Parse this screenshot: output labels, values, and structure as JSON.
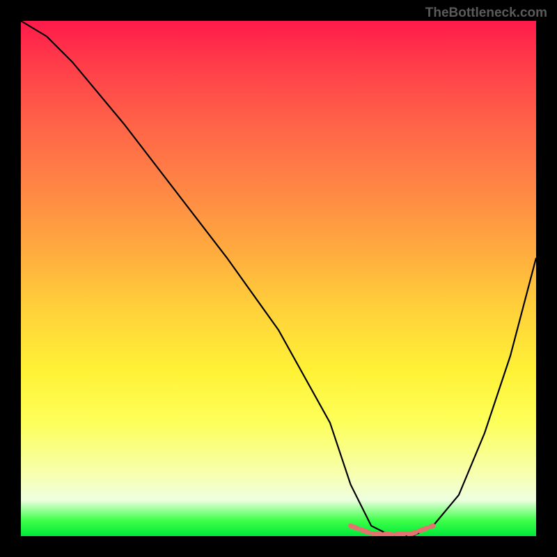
{
  "watermark": "TheBottleneck.com",
  "chart_data": {
    "type": "line",
    "title": "",
    "xlabel": "",
    "ylabel": "",
    "xlim": [
      0,
      100
    ],
    "ylim": [
      0,
      100
    ],
    "series": [
      {
        "name": "bottleneck-curve",
        "x": [
          0,
          5,
          10,
          20,
          30,
          40,
          50,
          60,
          64,
          68,
          72,
          76,
          80,
          85,
          90,
          95,
          100
        ],
        "values": [
          100,
          97,
          92,
          80,
          67,
          54,
          40,
          22,
          10,
          2,
          0,
          0,
          2,
          8,
          20,
          35,
          54
        ]
      },
      {
        "name": "optimal-range-marker",
        "x": [
          64,
          68,
          72,
          76,
          80
        ],
        "values": [
          2,
          0.5,
          0.3,
          0.5,
          2
        ]
      }
    ],
    "colors": {
      "curve": "#000000",
      "marker": "#e4736f",
      "gradient_top": "#ff1a4a",
      "gradient_mid": "#ffea36",
      "gradient_bottom": "#00e838"
    }
  }
}
